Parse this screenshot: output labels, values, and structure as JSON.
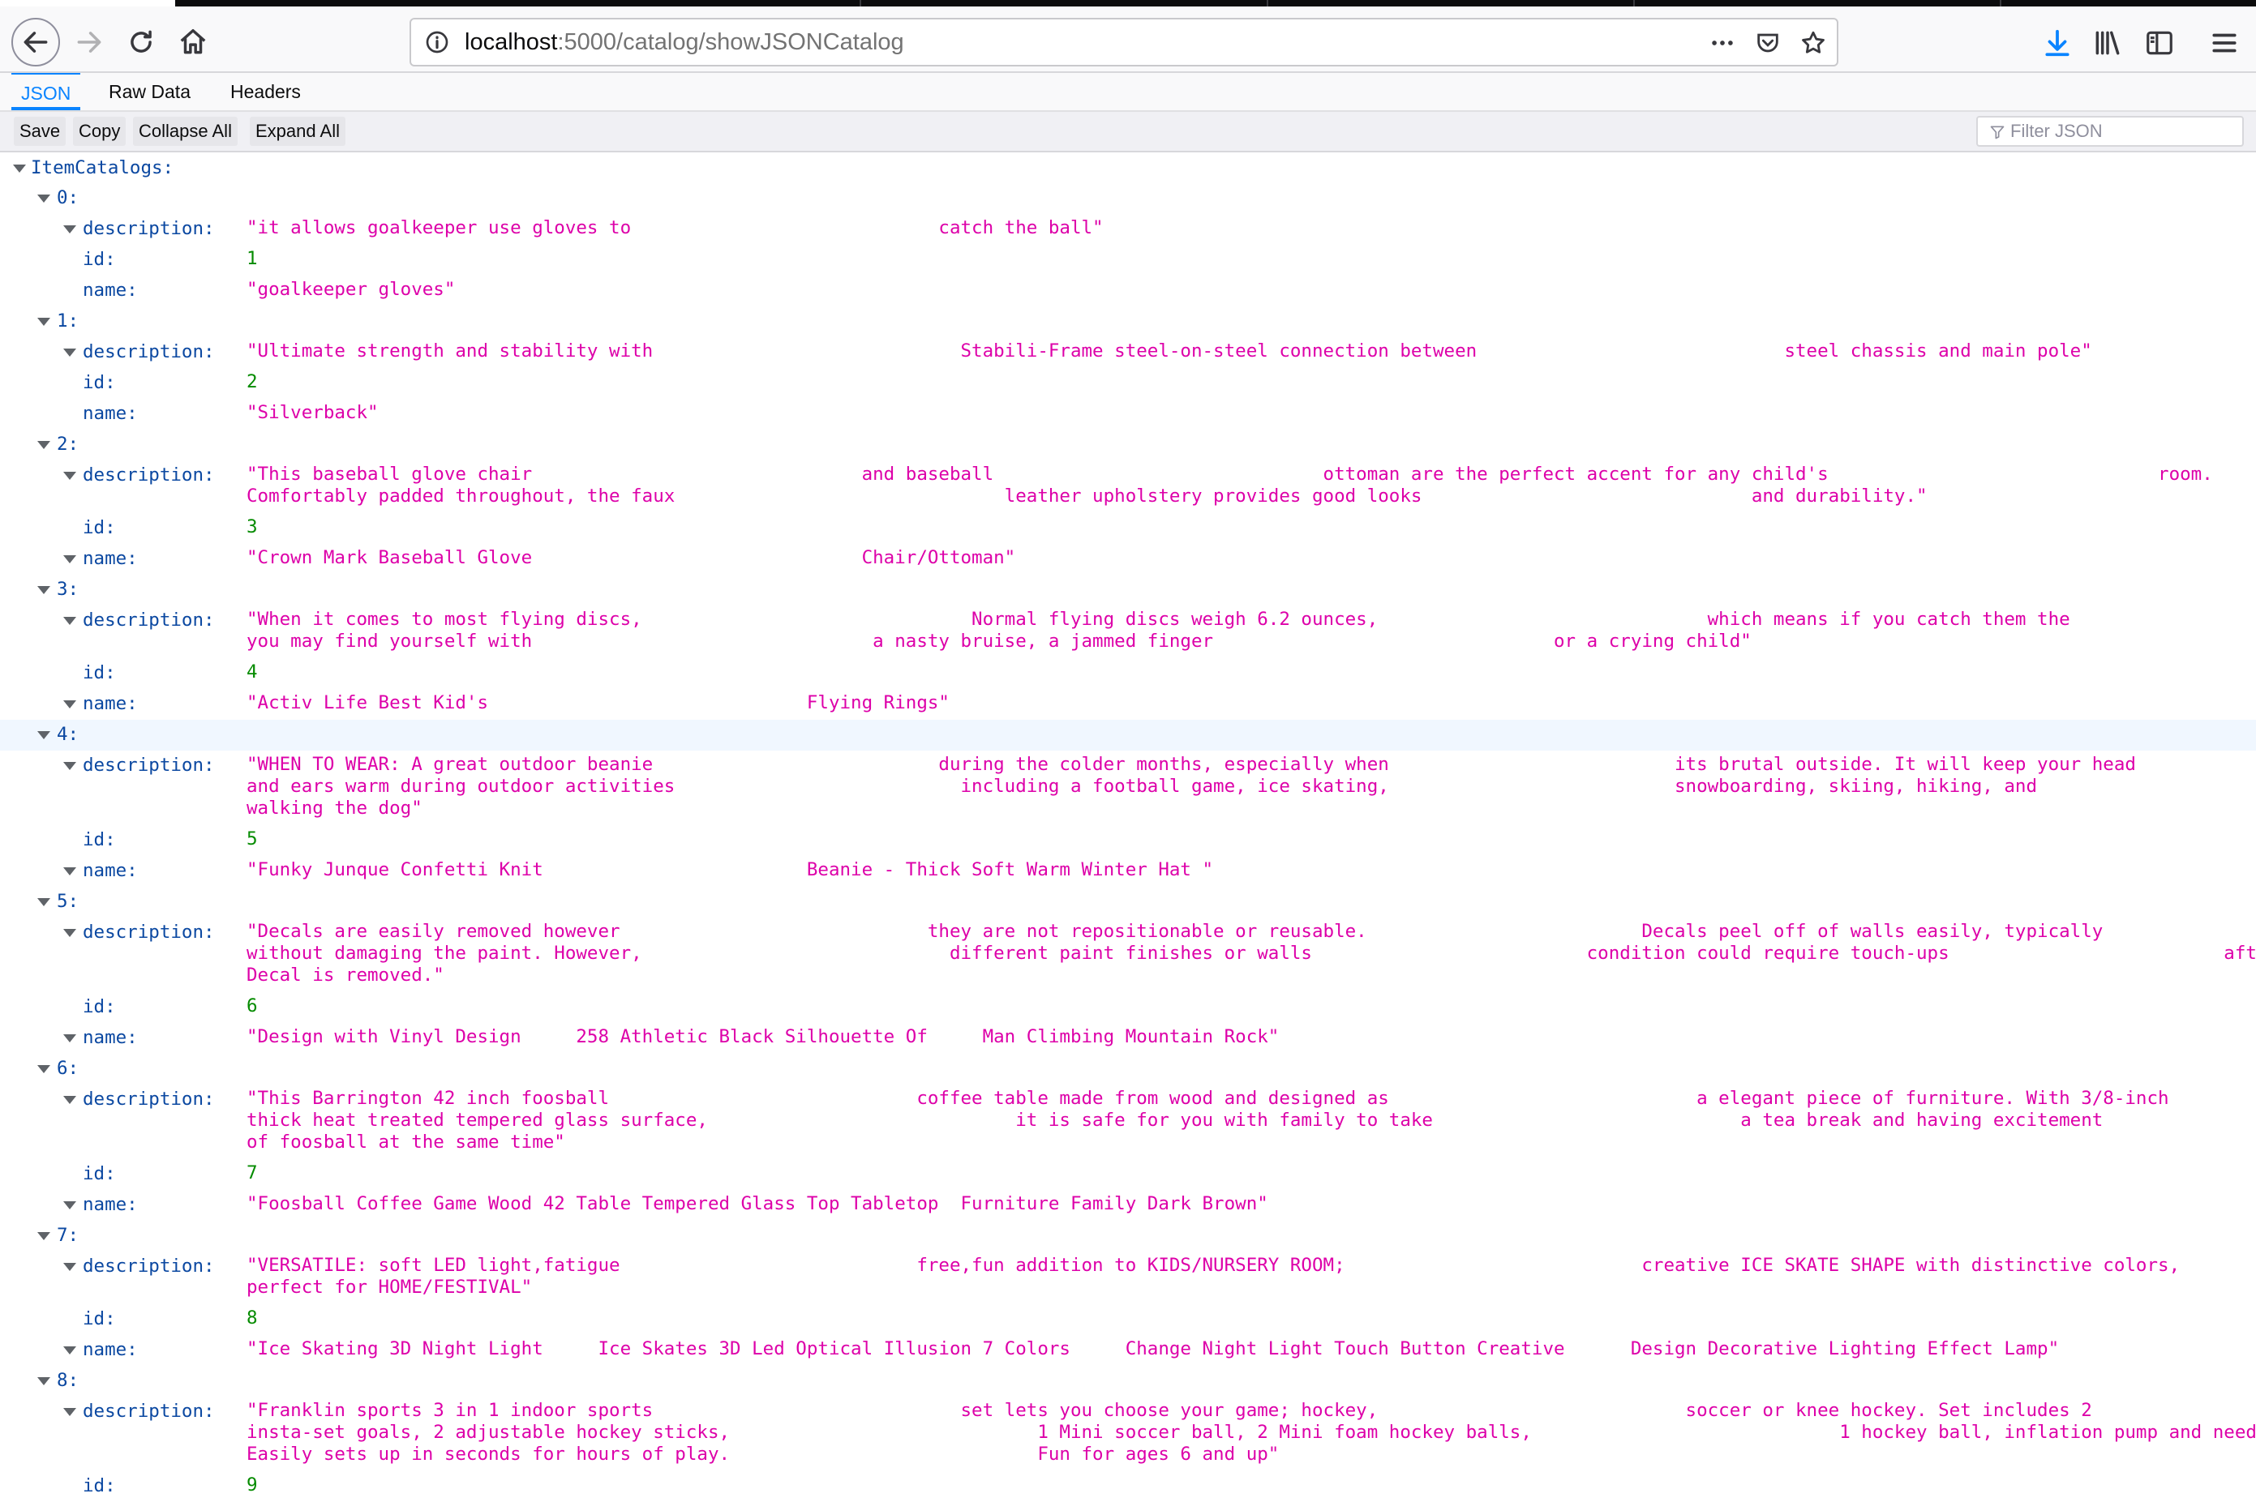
{
  "browser": {
    "url_host": "localhost",
    "url_path": ":5000/catalog/showJSONCatalog",
    "icons": [
      "back-icon",
      "forward-icon",
      "reload-icon",
      "home-icon",
      "info-icon",
      "more-icon",
      "pocket-icon",
      "bookmark-star-icon",
      "download-icon",
      "library-icon",
      "sidebar-icon",
      "menu-icon"
    ]
  },
  "viewer": {
    "tabs": [
      "JSON",
      "Raw Data",
      "Headers"
    ],
    "actions": [
      "Save",
      "Copy",
      "Collapse All",
      "Expand All"
    ],
    "filter_placeholder": "Filter JSON",
    "accent": "#0a84ff",
    "key_color": "#0b48a1",
    "string_color": "#dd00a9",
    "number_color": "#058b00"
  },
  "tree": {
    "root_key": "ItemCatalogs:",
    "items": [
      {
        "index": "0:",
        "desc": "\"it allows goalkeeper use gloves to                            catch the ball\"",
        "id": "1",
        "name": "\"goalkeeper gloves\""
      },
      {
        "index": "1:",
        "desc": "\"Ultimate strength and stability with                            Stabili-Frame steel-on-steel connection between                            steel chassis and main pole\"",
        "id": "2",
        "name": "\"Silverback\""
      },
      {
        "index": "2:",
        "desc": "\"This baseball glove chair                              and baseball                              ottoman are the perfect accent for any child's                              room.\nComfortably padded throughout, the faux                              leather upholstery provides good looks                              and durability.\"",
        "id": "3",
        "name": "\"Crown Mark Baseball Glove                              Chair/Ottoman\""
      },
      {
        "index": "3:",
        "desc": "\"When it comes to most flying discs,                              Normal flying discs weigh 6.2 ounces,                              which means if you catch them the\nyou may find yourself with                               a nasty bruise, a jammed finger                               or a crying child\"",
        "id": "4",
        "name": "\"Activ Life Best Kid's                             Flying Rings\""
      },
      {
        "index": "4:",
        "desc": "\"WHEN TO WEAR: A great outdoor beanie                          during the colder months, especially when                          its brutal outside. It will keep your head\nand ears warm during outdoor activities                          including a football game, ice skating,                          snowboarding, skiing, hiking, and\nwalking the dog\"",
        "id": "5",
        "name": "\"Funky Junque Confetti Knit                        Beanie - Thick Soft Warm Winter Hat \"",
        "highlight": true
      },
      {
        "index": "5:",
        "desc": "\"Decals are easily removed however                            they are not repositionable or reusable.                         Decals peel off of walls easily, typically\nwithout damaging the paint. However,                            different paint finishes or walls                         condition could require touch-ups                         after\nDecal is removed.\"",
        "id": "6",
        "name": "\"Design with Vinyl Design     258 Athletic Black Silhouette Of     Man Climbing Mountain Rock\""
      },
      {
        "index": "6:",
        "desc": "\"This Barrington 42 inch foosball                            coffee table made from wood and designed as                            a elegant piece of furniture. With 3/8-inch\nthick heat treated tempered glass surface,                            it is safe for you with family to take                            a tea break and having excitement\nof foosball at the same time\"",
        "id": "7",
        "name": "\"Foosball Coffee Game Wood 42 Table Tempered Glass Top Tabletop  Furniture Family Dark Brown\""
      },
      {
        "index": "7:",
        "desc": "\"VERSATILE: soft LED light,fatigue                           free,fun addition to KIDS/NURSERY ROOM;                           creative ICE SKATE SHAPE with distinctive colors,\nperfect for HOME/FESTIVAL\"",
        "id": "8",
        "name": "\"Ice Skating 3D Night Light     Ice Skates 3D Led Optical Illusion 7 Colors     Change Night Light Touch Button Creative      Design Decorative Lighting Effect Lamp\""
      },
      {
        "index": "8:",
        "desc": "\"Franklin sports 3 in 1 indoor sports                            set lets you choose your game; hockey,                            soccer or knee hockey. Set includes 2\ninsta-set goals, 2 adjustable hockey sticks,                            1 Mini soccer ball, 2 Mini foam hockey balls,                            1 hockey ball, inflation pump and needle.\nEasily sets up in seconds for hours of play.                            Fun for ages 6 and up\"",
        "id": "9"
      }
    ],
    "labels": {
      "description": "description:",
      "id": "id:",
      "name": "name:"
    }
  }
}
